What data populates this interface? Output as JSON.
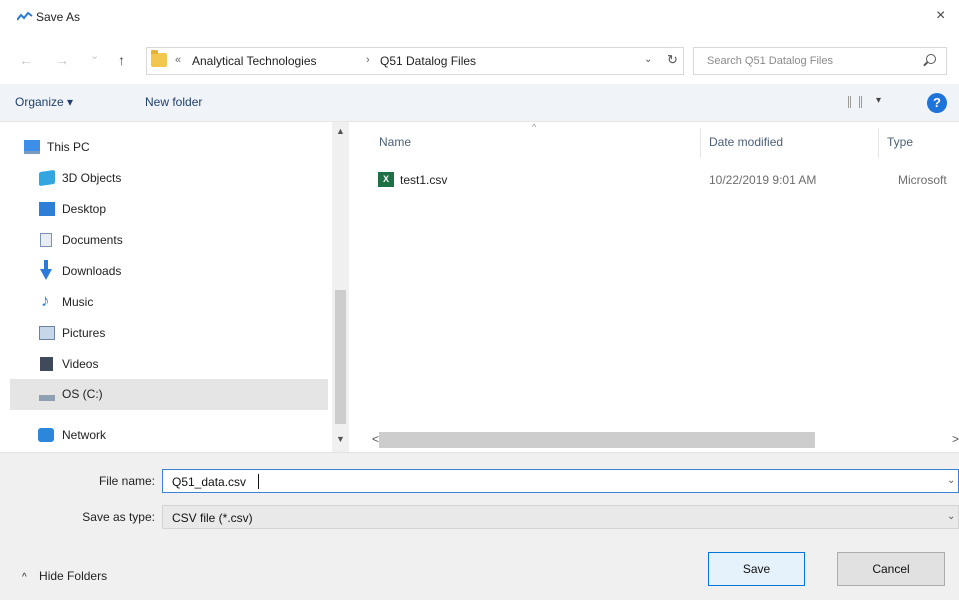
{
  "window": {
    "title": "Save As",
    "close_symbol": "×",
    "icons": {
      "app": "save-as-app-icon",
      "close": "close-icon"
    }
  },
  "navigation": {
    "back_symbol": "←",
    "forward_symbol": "→",
    "recent_symbol": "⌄",
    "up_symbol": "↑"
  },
  "address_bar": {
    "overflow_symbol": "«",
    "separator_symbol": "›",
    "crumbs": [
      "Analytical Technologies",
      "Q51 Datalog Files"
    ],
    "dropdown_symbol": "⌄",
    "refresh_symbol": "↻"
  },
  "search": {
    "placeholder": "Search Q51 Datalog Files"
  },
  "toolbar": {
    "organize_label": "Organize ▾",
    "new_folder_label": "New folder",
    "view_dropdown_symbol": "▾",
    "help_symbol": "?"
  },
  "nav_pane": {
    "items": [
      {
        "label": "This PC",
        "icon": "this-pc-icon"
      },
      {
        "label": "3D Objects",
        "icon": "3d-objects-icon"
      },
      {
        "label": "Desktop",
        "icon": "desktop-icon"
      },
      {
        "label": "Documents",
        "icon": "documents-icon"
      },
      {
        "label": "Downloads",
        "icon": "downloads-icon"
      },
      {
        "label": "Music",
        "icon": "music-icon"
      },
      {
        "label": "Pictures",
        "icon": "pictures-icon"
      },
      {
        "label": "Videos",
        "icon": "videos-icon"
      },
      {
        "label": "OS (C:)",
        "icon": "drive-icon",
        "selected": true
      },
      {
        "label": "Network",
        "icon": "network-icon"
      }
    ],
    "music_glyph": "♪",
    "scroll_up_symbol": "▲",
    "scroll_down_symbol": "▼"
  },
  "file_list": {
    "sort_indicator": "^",
    "columns": [
      "Name",
      "Date modified",
      "Type"
    ],
    "files": [
      {
        "name": "test1.csv",
        "date_modified": "10/22/2019 9:01 AM",
        "type": "Microsoft",
        "icon": "excel-csv-icon",
        "icon_text": "X"
      }
    ],
    "scroll_left_symbol": "<",
    "scroll_right_symbol": ">"
  },
  "form": {
    "file_name_label": "File name:",
    "file_name_value": "Q51_data.csv",
    "save_type_label": "Save as type:",
    "save_type_value": "CSV file (*.csv)",
    "dropdown_symbol": "⌄"
  },
  "footer": {
    "hide_folders_chevron": "^",
    "hide_folders_label": "Hide Folders",
    "save_label": "Save",
    "cancel_label": "Cancel"
  },
  "colors": {
    "accent": "#0078d7",
    "command_bar": "#f0f4f9",
    "selection": "#e5e5e5",
    "excel_green": "#1e7145",
    "folder_yellow": "#f3c74d"
  }
}
